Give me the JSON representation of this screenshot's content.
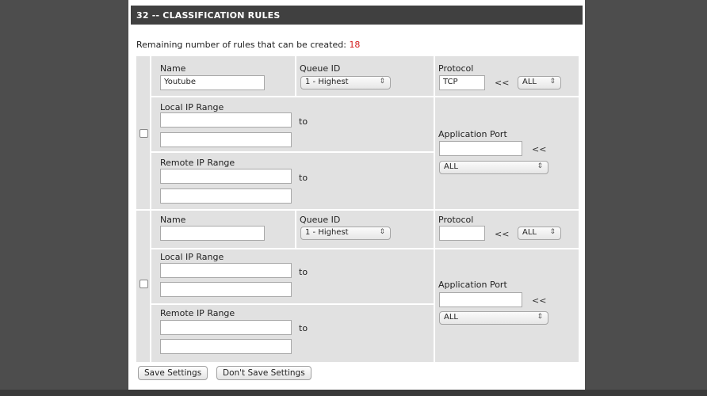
{
  "header": {
    "title": "32 -- CLASSIFICATION RULES"
  },
  "remaining": {
    "label": "Remaining number of rules that can be created:",
    "count": "18"
  },
  "labels": {
    "name": "Name",
    "queue_id": "Queue ID",
    "protocol": "Protocol",
    "local_ip_range": "Local IP Range",
    "remote_ip_range": "Remote IP Range",
    "application_port": "Application Port",
    "to": "to",
    "lt": "<<"
  },
  "rules": [
    {
      "name": "Youtube",
      "queue_id": "1 - Highest",
      "protocol_value": "TCP",
      "protocol_select": "ALL",
      "local_ip_start": "",
      "local_ip_end": "",
      "remote_ip_start": "",
      "remote_ip_end": "",
      "app_port": "",
      "app_port_select": "ALL",
      "checked": false
    },
    {
      "name": "",
      "queue_id": "1 - Highest",
      "protocol_value": "",
      "protocol_select": "ALL",
      "local_ip_start": "",
      "local_ip_end": "",
      "remote_ip_start": "",
      "remote_ip_end": "",
      "app_port": "",
      "app_port_select": "ALL",
      "checked": false
    }
  ],
  "buttons": {
    "save": "Save Settings",
    "dont_save": "Don't Save Settings"
  }
}
